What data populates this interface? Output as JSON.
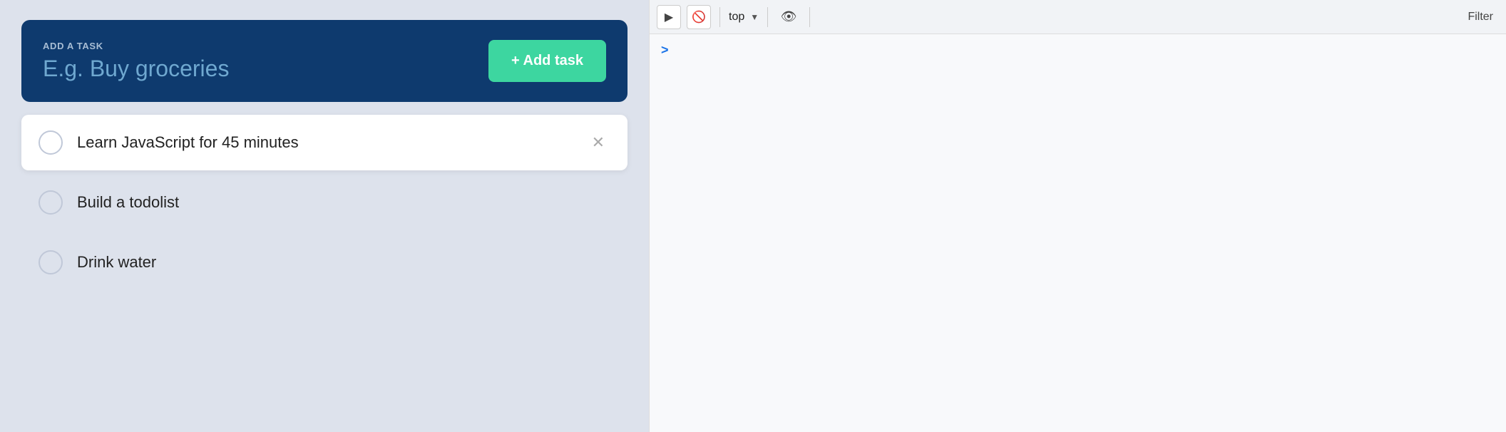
{
  "todo": {
    "add_task_label": "Add a task",
    "add_task_placeholder": "E.g. Buy groceries",
    "add_task_button": "+ Add task",
    "tasks": [
      {
        "id": 1,
        "text": "Learn JavaScript for 45 minutes",
        "completed": false,
        "hovered": true
      },
      {
        "id": 2,
        "text": "Build a todolist",
        "completed": false,
        "hovered": false
      },
      {
        "id": 3,
        "text": "Drink water",
        "completed": false,
        "hovered": false
      }
    ]
  },
  "devtools": {
    "context_value": "top",
    "filter_label": "Filter",
    "icons": {
      "play": "▶",
      "ban": "⊘",
      "eye": "👁",
      "chevron": "▼",
      "arrow_right": "›"
    }
  }
}
